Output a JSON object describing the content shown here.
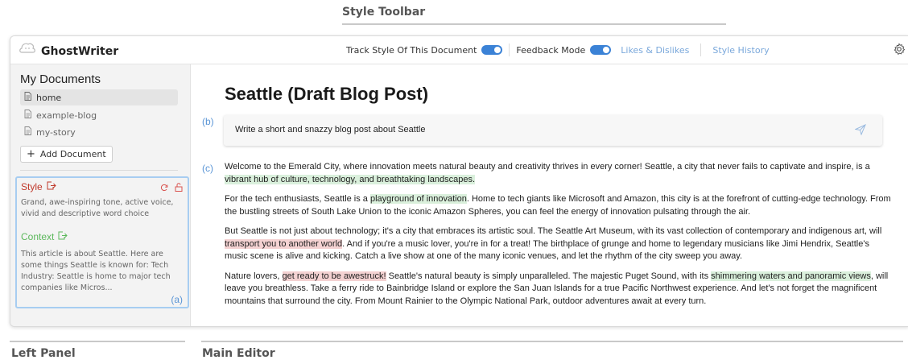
{
  "captions": {
    "style_toolbar": "Style Toolbar",
    "left_panel": "Left Panel",
    "main_editor": "Main Editor"
  },
  "app": {
    "name": "GhostWriter"
  },
  "toolbar": {
    "track_style_label": "Track Style Of This Document",
    "track_style_on": true,
    "feedback_label": "Feedback Mode",
    "feedback_on": true,
    "likes_label": "Likes & Dislikes",
    "history_label": "Style History"
  },
  "sidebar": {
    "title": "My Documents",
    "documents": [
      {
        "name": "home",
        "active": true
      },
      {
        "name": "example-blog",
        "active": false
      },
      {
        "name": "my-story",
        "active": false
      }
    ],
    "add_button": "Add Document",
    "style_heading": "Style",
    "style_text": "Grand, awe-inspiring tone, active voice, vivid and descriptive word choice",
    "context_heading": "Context",
    "context_text": "This article is about Seattle. Here are some things Seattle is known for: Tech Industry: Seattle is home to major tech companies like Micros...",
    "annotation": "(a)"
  },
  "editor": {
    "title": "Seattle (Draft Blog Post)",
    "prompt_annotation": "(b)",
    "prompt_text": "Write a short and snazzy blog post about Seattle",
    "body_annotation": "(c)",
    "paragraphs": [
      [
        {
          "t": "Welcome to the Emerald City, where innovation meets natural beauty and creativity thrives in every corner! Seattle, a city that never fails to captivate and inspire, is a ",
          "h": ""
        },
        {
          "t": "vibrant hub of culture, technology, and breathtaking landscapes.",
          "h": "g"
        }
      ],
      [
        {
          "t": "For the tech enthusiasts, Seattle is a ",
          "h": ""
        },
        {
          "t": "playground of innovation",
          "h": "g"
        },
        {
          "t": ". Home to tech giants like Microsoft and Amazon, this city is at the forefront of cutting-edge technology. From the bustling streets of South Lake Union to the iconic Amazon Spheres, you can feel the energy of innovation pulsating through the air.",
          "h": ""
        }
      ],
      [
        {
          "t": "But Seattle is not just about technology; it's a city that embraces its artistic soul. The Seattle Art Museum, with its vast collection of contemporary and indigenous art, will ",
          "h": ""
        },
        {
          "t": "transport you to another world",
          "h": "r"
        },
        {
          "t": ". And if you're a music lover, you're in for a treat! The birthplace of grunge and home to legendary musicians like Jimi Hendrix, Seattle's music scene is alive and kicking. Catch a live show at one of the many iconic venues, and let the rhythm of the city sweep you away.",
          "h": ""
        }
      ],
      [
        {
          "t": "Nature lovers, ",
          "h": ""
        },
        {
          "t": "get ready to be awestruck!",
          "h": "r"
        },
        {
          "t": " Seattle's natural beauty is simply unparalleled. The majestic Puget Sound, with its ",
          "h": ""
        },
        {
          "t": "shimmering waters and panoramic views",
          "h": "g"
        },
        {
          "t": ", will leave you breathless. Take a ferry ride to Bainbridge Island or explore the San Juan Islands for a true Pacific Northwest experience. And let's not forget the magnificent mountains that surround the city. From Mount Rainier to the Olympic National Park, outdoor adventures await at every turn.",
          "h": ""
        }
      ]
    ]
  },
  "colors": {
    "accent": "#3b82d6",
    "style_heading": "#c0392b",
    "context_heading": "#5cb85c",
    "highlight_like": "#daf0dc",
    "highlight_dislike": "#f4d2d2"
  }
}
